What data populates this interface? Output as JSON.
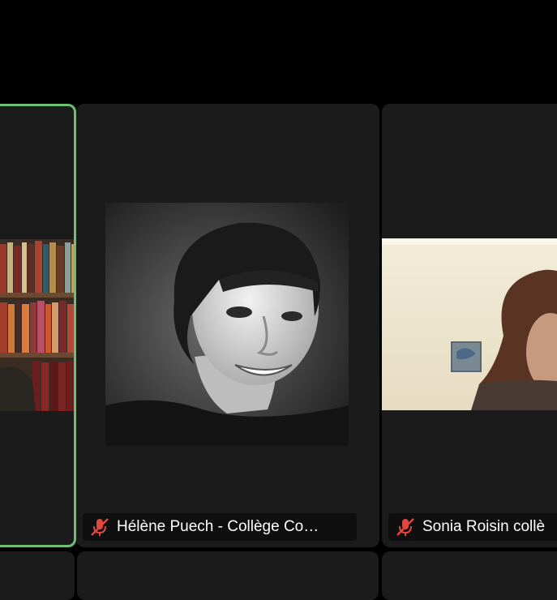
{
  "participants": [
    {
      "name": "",
      "muted": false,
      "active_speaker": true,
      "video": "bookshelf-background"
    },
    {
      "name": "Hélène Puech - Collège Co…",
      "muted": true,
      "active_speaker": false,
      "video": "portrait-photo"
    },
    {
      "name": "Sonia Roisin collè",
      "muted": true,
      "active_speaker": false,
      "video": "webcam-room"
    }
  ],
  "colors": {
    "background": "#000000",
    "tile": "#1b1b1b",
    "active_border": "#6fbf73",
    "muted_icon": "#e0483e"
  },
  "icons": {
    "mic_muted": "mic-muted-icon"
  }
}
